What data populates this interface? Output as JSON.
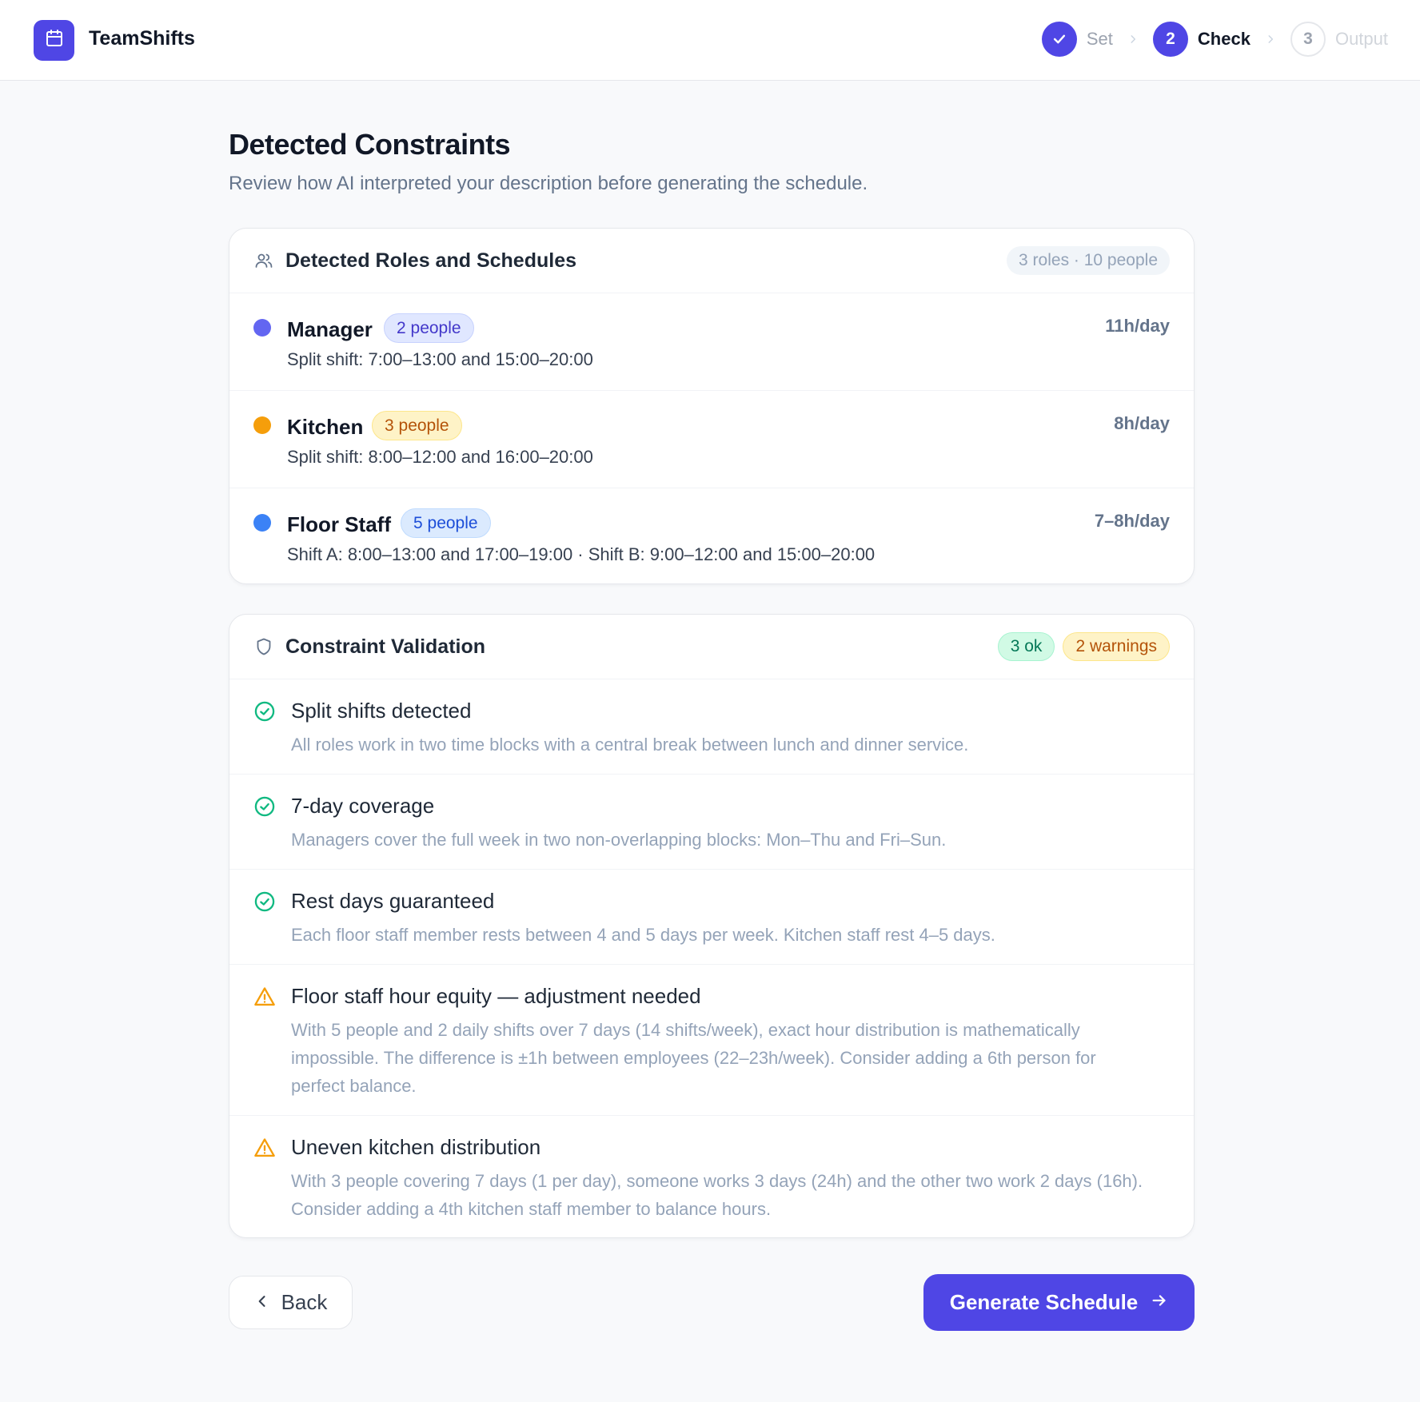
{
  "app": {
    "brand": "TeamShifts",
    "logo_icon": "calendar-icon",
    "accent": "#4f46e5"
  },
  "stepper": {
    "steps": [
      {
        "label": "Set",
        "number": "1",
        "state": "done"
      },
      {
        "label": "Check",
        "number": "2",
        "state": "active"
      },
      {
        "label": "Output",
        "number": "3",
        "state": "pending"
      }
    ]
  },
  "page": {
    "title": "Detected Constraints",
    "subtitle": "Review how AI interpreted your description before generating the schedule."
  },
  "roles_card": {
    "title": "Detected Roles and Schedules",
    "summary": "3 roles · 10 people",
    "roles": [
      {
        "name": "Manager",
        "people": "2 people",
        "shift": "Split shift: 7:00–13:00 and 15:00–20:00",
        "hours": "11h/day",
        "color": "#6366f1"
      },
      {
        "name": "Kitchen",
        "people": "3 people",
        "shift": "Split shift: 8:00–12:00 and 16:00–20:00",
        "hours": "8h/day",
        "color": "#f59e0b"
      },
      {
        "name": "Floor Staff",
        "people": "5 people",
        "shift": "Shift A: 8:00–13:00 and 17:00–19:00 · Shift B: 9:00–12:00 and 15:00–20:00",
        "hours": "7–8h/day",
        "color": "#3b82f6"
      }
    ]
  },
  "validation_card": {
    "title": "Constraint Validation",
    "ok_count": "3 ok",
    "warn_count": "2 warnings",
    "items": [
      {
        "status": "ok",
        "title": "Split shifts detected",
        "desc": "All roles work in two time blocks with a central break between lunch and dinner service."
      },
      {
        "status": "ok",
        "title": "7-day coverage",
        "desc": "Managers cover the full week in two non-overlapping blocks: Mon–Thu and Fri–Sun."
      },
      {
        "status": "ok",
        "title": "Rest days guaranteed",
        "desc": "Each floor staff member rests between 4 and 5 days per week. Kitchen staff rest 4–5 days."
      },
      {
        "status": "warning",
        "title": "Floor staff hour equity — adjustment needed",
        "desc": "With 5 people and 2 daily shifts over 7 days (14 shifts/week), exact hour distribution is mathematically impossible. The difference is ±1h between employees (22–23h/week). Consider adding a 6th person for perfect balance."
      },
      {
        "status": "warning",
        "title": "Uneven kitchen distribution",
        "desc": "With 3 people covering 7 days (1 per day), someone works 3 days (24h) and the other two work 2 days (16h). Consider adding a 4th kitchen staff member to balance hours."
      }
    ]
  },
  "actions": {
    "back_label": "Back",
    "generate_label": "Generate Schedule"
  }
}
